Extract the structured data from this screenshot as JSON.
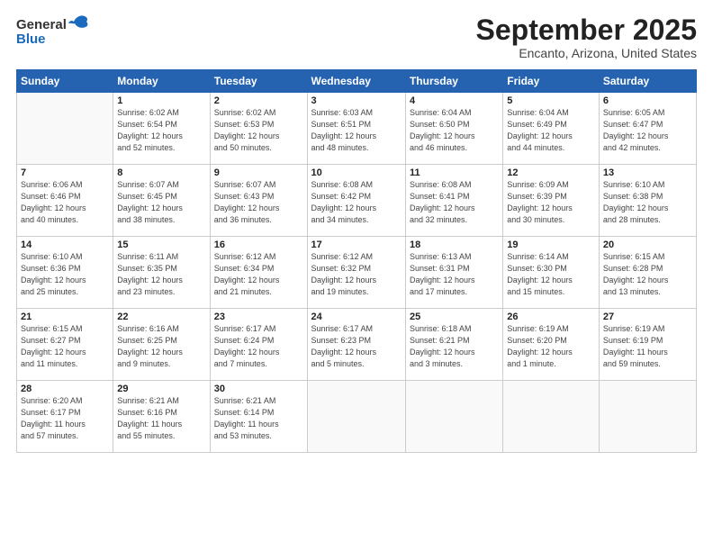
{
  "logo": {
    "general": "General",
    "blue": "Blue"
  },
  "title": "September 2025",
  "location": "Encanto, Arizona, United States",
  "days_header": [
    "Sunday",
    "Monday",
    "Tuesday",
    "Wednesday",
    "Thursday",
    "Friday",
    "Saturday"
  ],
  "weeks": [
    [
      {
        "day": "",
        "info": ""
      },
      {
        "day": "1",
        "info": "Sunrise: 6:02 AM\nSunset: 6:54 PM\nDaylight: 12 hours\nand 52 minutes."
      },
      {
        "day": "2",
        "info": "Sunrise: 6:02 AM\nSunset: 6:53 PM\nDaylight: 12 hours\nand 50 minutes."
      },
      {
        "day": "3",
        "info": "Sunrise: 6:03 AM\nSunset: 6:51 PM\nDaylight: 12 hours\nand 48 minutes."
      },
      {
        "day": "4",
        "info": "Sunrise: 6:04 AM\nSunset: 6:50 PM\nDaylight: 12 hours\nand 46 minutes."
      },
      {
        "day": "5",
        "info": "Sunrise: 6:04 AM\nSunset: 6:49 PM\nDaylight: 12 hours\nand 44 minutes."
      },
      {
        "day": "6",
        "info": "Sunrise: 6:05 AM\nSunset: 6:47 PM\nDaylight: 12 hours\nand 42 minutes."
      }
    ],
    [
      {
        "day": "7",
        "info": "Sunrise: 6:06 AM\nSunset: 6:46 PM\nDaylight: 12 hours\nand 40 minutes."
      },
      {
        "day": "8",
        "info": "Sunrise: 6:07 AM\nSunset: 6:45 PM\nDaylight: 12 hours\nand 38 minutes."
      },
      {
        "day": "9",
        "info": "Sunrise: 6:07 AM\nSunset: 6:43 PM\nDaylight: 12 hours\nand 36 minutes."
      },
      {
        "day": "10",
        "info": "Sunrise: 6:08 AM\nSunset: 6:42 PM\nDaylight: 12 hours\nand 34 minutes."
      },
      {
        "day": "11",
        "info": "Sunrise: 6:08 AM\nSunset: 6:41 PM\nDaylight: 12 hours\nand 32 minutes."
      },
      {
        "day": "12",
        "info": "Sunrise: 6:09 AM\nSunset: 6:39 PM\nDaylight: 12 hours\nand 30 minutes."
      },
      {
        "day": "13",
        "info": "Sunrise: 6:10 AM\nSunset: 6:38 PM\nDaylight: 12 hours\nand 28 minutes."
      }
    ],
    [
      {
        "day": "14",
        "info": "Sunrise: 6:10 AM\nSunset: 6:36 PM\nDaylight: 12 hours\nand 25 minutes."
      },
      {
        "day": "15",
        "info": "Sunrise: 6:11 AM\nSunset: 6:35 PM\nDaylight: 12 hours\nand 23 minutes."
      },
      {
        "day": "16",
        "info": "Sunrise: 6:12 AM\nSunset: 6:34 PM\nDaylight: 12 hours\nand 21 minutes."
      },
      {
        "day": "17",
        "info": "Sunrise: 6:12 AM\nSunset: 6:32 PM\nDaylight: 12 hours\nand 19 minutes."
      },
      {
        "day": "18",
        "info": "Sunrise: 6:13 AM\nSunset: 6:31 PM\nDaylight: 12 hours\nand 17 minutes."
      },
      {
        "day": "19",
        "info": "Sunrise: 6:14 AM\nSunset: 6:30 PM\nDaylight: 12 hours\nand 15 minutes."
      },
      {
        "day": "20",
        "info": "Sunrise: 6:15 AM\nSunset: 6:28 PM\nDaylight: 12 hours\nand 13 minutes."
      }
    ],
    [
      {
        "day": "21",
        "info": "Sunrise: 6:15 AM\nSunset: 6:27 PM\nDaylight: 12 hours\nand 11 minutes."
      },
      {
        "day": "22",
        "info": "Sunrise: 6:16 AM\nSunset: 6:25 PM\nDaylight: 12 hours\nand 9 minutes."
      },
      {
        "day": "23",
        "info": "Sunrise: 6:17 AM\nSunset: 6:24 PM\nDaylight: 12 hours\nand 7 minutes."
      },
      {
        "day": "24",
        "info": "Sunrise: 6:17 AM\nSunset: 6:23 PM\nDaylight: 12 hours\nand 5 minutes."
      },
      {
        "day": "25",
        "info": "Sunrise: 6:18 AM\nSunset: 6:21 PM\nDaylight: 12 hours\nand 3 minutes."
      },
      {
        "day": "26",
        "info": "Sunrise: 6:19 AM\nSunset: 6:20 PM\nDaylight: 12 hours\nand 1 minute."
      },
      {
        "day": "27",
        "info": "Sunrise: 6:19 AM\nSunset: 6:19 PM\nDaylight: 11 hours\nand 59 minutes."
      }
    ],
    [
      {
        "day": "28",
        "info": "Sunrise: 6:20 AM\nSunset: 6:17 PM\nDaylight: 11 hours\nand 57 minutes."
      },
      {
        "day": "29",
        "info": "Sunrise: 6:21 AM\nSunset: 6:16 PM\nDaylight: 11 hours\nand 55 minutes."
      },
      {
        "day": "30",
        "info": "Sunrise: 6:21 AM\nSunset: 6:14 PM\nDaylight: 11 hours\nand 53 minutes."
      },
      {
        "day": "",
        "info": ""
      },
      {
        "day": "",
        "info": ""
      },
      {
        "day": "",
        "info": ""
      },
      {
        "day": "",
        "info": ""
      }
    ]
  ]
}
